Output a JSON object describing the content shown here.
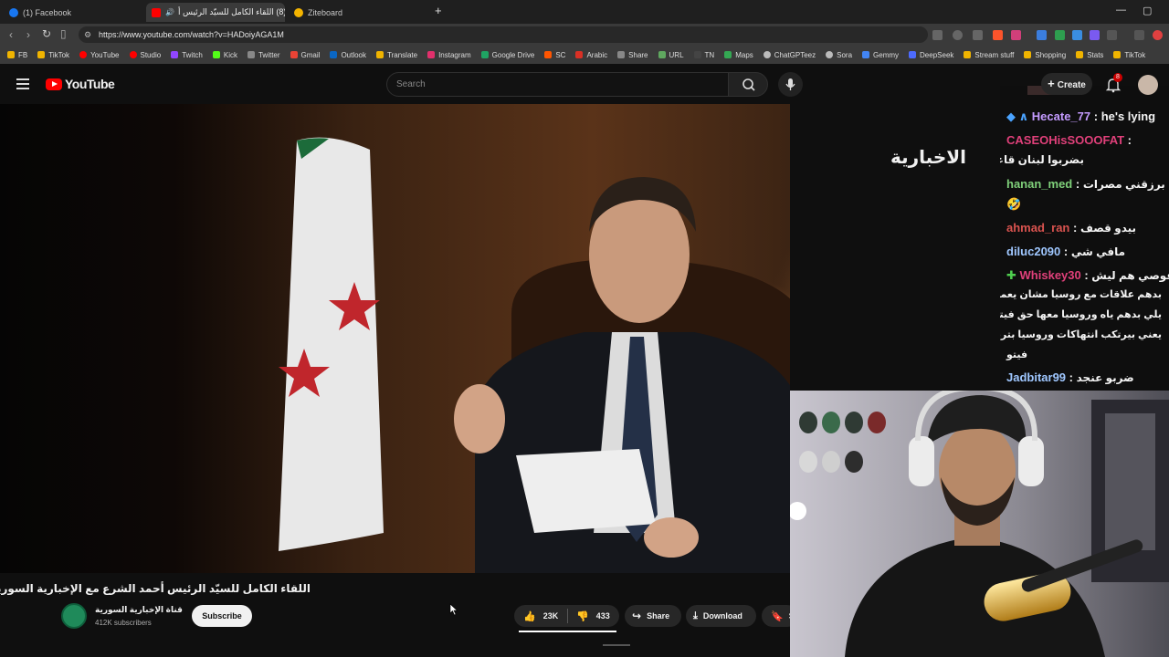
{
  "browser": {
    "tabs": [
      {
        "label": "(1) Facebook",
        "color": "#1877f2"
      },
      {
        "label": "(8) اللقاء الكامل للسيّد الرئيس أ",
        "color": "#ff0000"
      },
      {
        "label": "Ziteboard",
        "color": "#f4b400"
      }
    ],
    "new_tab": "+",
    "url": "https://www.youtube.com/watch?v=HADoiyAGA1M",
    "bookmarks": [
      {
        "label": "FB",
        "color": "#f0b400"
      },
      {
        "label": "TikTok",
        "color": "#f0b400"
      },
      {
        "label": "YouTube",
        "color": "#ff0000"
      },
      {
        "label": "Studio",
        "color": "#ff0000"
      },
      {
        "label": "Twitch",
        "color": "#9146ff"
      },
      {
        "label": "Kick",
        "color": "#53fc18"
      },
      {
        "label": "Twitter",
        "color": "#222222"
      },
      {
        "label": "Gmail",
        "color": "#ea4335"
      },
      {
        "label": "Outlook",
        "color": "#0a66c2"
      },
      {
        "label": "Translate",
        "color": "#f0b400"
      },
      {
        "label": "Instagram",
        "color": "#e1306c"
      },
      {
        "label": "Google Drive",
        "color": "#1fa463"
      },
      {
        "label": "SC",
        "color": "#ff5500"
      },
      {
        "label": "Arabic",
        "color": "#d93025"
      },
      {
        "label": "Share",
        "color": "#888888"
      },
      {
        "label": "URL",
        "color": "#5fa85f"
      },
      {
        "label": "TN",
        "color": "#444444"
      },
      {
        "label": "Maps",
        "color": "#34a853"
      },
      {
        "label": "ChatGPTeez",
        "color": "#bbbbbb"
      },
      {
        "label": "Sora",
        "color": "#bbbbbb"
      },
      {
        "label": "Gemmy",
        "color": "#4285f4"
      },
      {
        "label": "DeepSeek",
        "color": "#4d6bfe"
      },
      {
        "label": "Stream stuff",
        "color": "#f0b400"
      },
      {
        "label": "Shopping",
        "color": "#f0b400"
      },
      {
        "label": "Stats",
        "color": "#f0b400"
      },
      {
        "label": "TikTok",
        "color": "#f0b400"
      }
    ]
  },
  "youtube": {
    "logo_text": "YouTube",
    "search_placeholder": "Search",
    "create_label": "Create",
    "notif_count": "8"
  },
  "video": {
    "watermark": "الاخبارية",
    "title": "اللقاء الكامل للسيّد الرئيس أحمد الشرع مع الإخبارية السورية",
    "channel": "قناة الإخبارية السورية",
    "subscribers": "412K subscribers",
    "subscribe_label": "Subscribe",
    "likes": "23K",
    "dislikes": "433",
    "share_label": "Share",
    "download_label": "Download",
    "more_label": "S"
  },
  "chat": {
    "messages": [
      {
        "name": "Hecate_77",
        "name_color": "#c49bff",
        "sep": " : ",
        "msg": "he's lying",
        "prefix": "◆ ∧"
      },
      {
        "name": "CASEOHisSOOOFAT",
        "name_color": "#e0407a",
        "sep": " :",
        "msg": "",
        "prefix": ""
      },
      {
        "name": "",
        "name_color": "#ffffff",
        "sep": "",
        "msg": "بضربوا لبنان قاعدين",
        "prefix": ""
      },
      {
        "name": "hanan_med",
        "name_color": "#7fd07a",
        "sep": " : ",
        "msg": "برزقني مصرات",
        "prefix": ""
      },
      {
        "name": "",
        "name_color": "#ffffff",
        "sep": "",
        "msg": "🤣",
        "prefix": ""
      },
      {
        "name": "ahmad_ran",
        "name_color": "#d9534f",
        "sep": " : ",
        "msg": "بيدو قصف",
        "prefix": ""
      },
      {
        "name": "diluc2090",
        "name_color": "#9fc7ff",
        "sep": " : ",
        "msg": "مافي شي",
        "prefix": ""
      },
      {
        "name": "Whiskey30",
        "name_color": "#e0407a",
        "sep": " : ",
        "msg": "قوصي هم ليش",
        "prefix": "✚"
      },
      {
        "name": "",
        "name_color": "#ffffff",
        "sep": "",
        "msg": "بدهم علاقات مع روسيا مشان يعملوا",
        "prefix": ""
      },
      {
        "name": "",
        "name_color": "#ffffff",
        "sep": "",
        "msg": "يلي بدهم ياه وروسيا معها حق فيتو",
        "prefix": ""
      },
      {
        "name": "",
        "name_color": "#ffffff",
        "sep": "",
        "msg": "يعني بيرتكب انتهاكات وروسيا بترفع",
        "prefix": ""
      },
      {
        "name": "",
        "name_color": "#ffffff",
        "sep": "",
        "msg": "فيتو",
        "prefix": ""
      },
      {
        "name": "Jadbitar99",
        "name_color": "#9fc7ff",
        "sep": " : ",
        "msg": "ضربو عنجد",
        "prefix": ""
      }
    ]
  }
}
